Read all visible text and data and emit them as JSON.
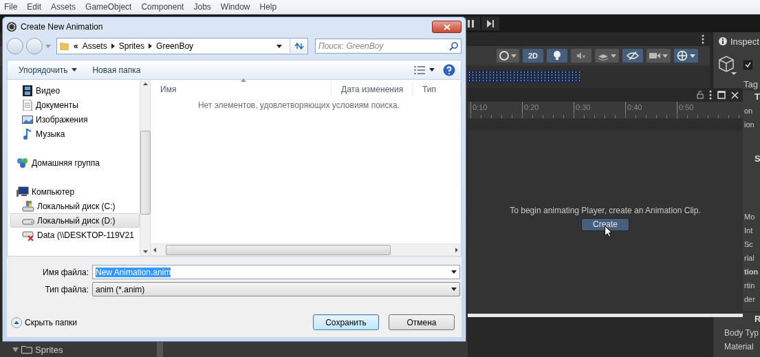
{
  "menu_bar": [
    "File",
    "Edit",
    "Assets",
    "GameObject",
    "Component",
    "Jobs",
    "Window",
    "Help"
  ],
  "scene_toolbar": [
    {
      "kind": "shading",
      "on": false
    },
    {
      "kind": "mode",
      "label": "2D",
      "on": true
    },
    {
      "kind": "lighting",
      "on": true
    },
    {
      "kind": "audio",
      "on": false
    },
    {
      "kind": "effects",
      "on": false
    },
    {
      "kind": "visibility",
      "on": true
    },
    {
      "kind": "camera",
      "on": false
    },
    {
      "kind": "gizmos",
      "on": true
    }
  ],
  "inspector": {
    "tab": "Inspect",
    "active_checked": true,
    "tag_label": "Tag",
    "sections": [
      {
        "header": "T",
        "fields": [
          {
            "text": "on",
            "bold": false
          },
          {
            "text": "ion",
            "bold": false
          }
        ]
      },
      {
        "header": "S",
        "fields": [
          {
            "text": "Mo",
            "bold": false
          },
          {
            "text": "Int",
            "bold": false
          },
          {
            "text": "Sc",
            "bold": false
          },
          {
            "text": "rial",
            "bold": false
          },
          {
            "text": "tion",
            "bold": true
          },
          {
            "text": "rtin",
            "bold": false
          },
          {
            "text": "der",
            "bold": false
          }
        ]
      },
      {
        "header": "R",
        "fields": [
          {
            "text": "Body Typ",
            "bold": false
          },
          {
            "text": "Material",
            "bold": false
          }
        ]
      }
    ]
  },
  "animation_window": {
    "ruler": [
      "0:10",
      "0:20",
      "0:30",
      "0:40",
      "0:50"
    ],
    "message": "To begin animating Player, create an Animation Clip.",
    "create_button": "Create"
  },
  "project": {
    "folder": "Sprites",
    "expanded": true
  },
  "dialog": {
    "title": "Create New Animation",
    "address": {
      "overflow_mark": "«",
      "path": [
        "Assets",
        "Sprites",
        "GreenBoy"
      ]
    },
    "search": {
      "placeholder": "Поиск: GreenBoy"
    },
    "commands": [
      {
        "label": "Упорядочить",
        "dropdown": true
      },
      {
        "label": "Новая папка",
        "dropdown": false
      }
    ],
    "nav_groups": [
      {
        "items": [
          {
            "kind": "video",
            "label": "Видео",
            "selected": false
          },
          {
            "kind": "documents",
            "label": "Документы",
            "selected": false
          },
          {
            "kind": "pictures",
            "label": "Изображения",
            "selected": false
          },
          {
            "kind": "music",
            "label": "Музыка",
            "selected": false
          }
        ]
      },
      {
        "items": [
          {
            "kind": "homegroup",
            "label": "Домашняя группа",
            "selected": false
          }
        ]
      },
      {
        "items": [
          {
            "kind": "computer",
            "label": "Компьютер",
            "selected": false,
            "children": [
              {
                "kind": "system-drive",
                "label": "Локальный диск (C:)",
                "selected": false
              },
              {
                "kind": "drive",
                "label": "Локальный диск (D:)",
                "selected": true
              },
              {
                "kind": "network-drive",
                "label": "Data (\\\\DESKTOP-119V21",
                "selected": false
              }
            ]
          }
        ]
      }
    ],
    "columns": [
      {
        "label": "Имя",
        "sorted": true
      },
      {
        "label": "Дата изменения",
        "sorted": false
      },
      {
        "label": "Тип",
        "sorted": false
      }
    ],
    "empty_message": "Нет элементов, удовлетворяющих условиям поиска.",
    "file_name": {
      "label": "Имя файла:",
      "value": "New Animation.anim"
    },
    "file_type": {
      "label": "Тип файла:",
      "value": "anim (*.anim)"
    },
    "hide_folders": "Скрыть папки",
    "buttons": [
      {
        "label": "Сохранить",
        "default": true
      },
      {
        "label": "Отмена",
        "default": false
      }
    ]
  }
}
